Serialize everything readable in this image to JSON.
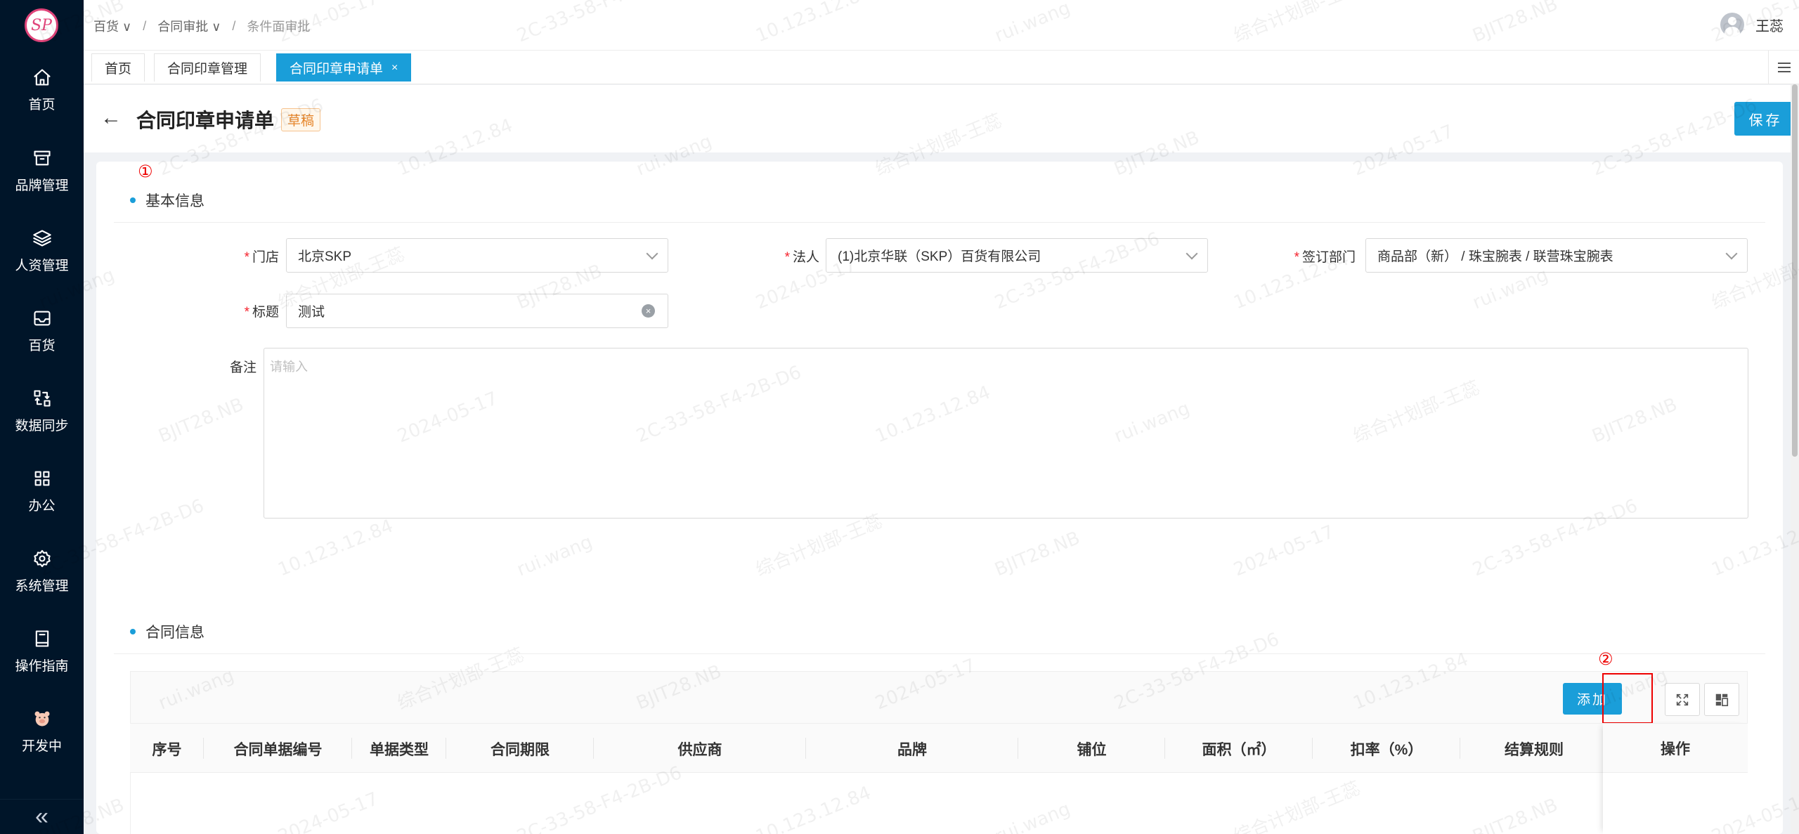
{
  "sidebar": {
    "logo_text": "SP",
    "items": [
      {
        "label": "首页",
        "icon": "home-icon"
      },
      {
        "label": "品牌管理",
        "icon": "archive-box-icon"
      },
      {
        "label": "人资管理",
        "icon": "layers-icon"
      },
      {
        "label": "百货",
        "icon": "inbox-icon"
      },
      {
        "label": "数据同步",
        "icon": "sync-icon"
      },
      {
        "label": "办公",
        "icon": "grid-icon"
      },
      {
        "label": "系统管理",
        "icon": "gear-icon"
      },
      {
        "label": "操作指南",
        "icon": "book-icon"
      },
      {
        "label": "开发中",
        "icon": "pig-icon"
      }
    ],
    "collapse_glyph": "«"
  },
  "header": {
    "breadcrumb": [
      "百货",
      "合同审批",
      "条件面审批"
    ],
    "user_name": "王蕊"
  },
  "tabs": [
    {
      "label": "首页"
    },
    {
      "label": "合同印章管理"
    },
    {
      "label": "合同印章申请单",
      "close": "×"
    }
  ],
  "page": {
    "title": "合同印章申请单",
    "status_badge": "草稿",
    "save_label": "保存",
    "back_glyph": "←"
  },
  "annotations": {
    "mark1": "①",
    "mark2": "②"
  },
  "basic_info": {
    "section_title": "基本信息",
    "store": {
      "label": "门店",
      "value": "北京SKP"
    },
    "legal_person": {
      "label": "法人",
      "value": "(1)北京华联（SKP）百货有限公司"
    },
    "department": {
      "label": "签订部门",
      "value": "商品部（新） / 珠宝腕表 / 联营珠宝腕表"
    },
    "title_field": {
      "label": "标题",
      "value": "测试"
    },
    "remark": {
      "label": "备注",
      "placeholder": "请输入"
    }
  },
  "contract_info": {
    "section_title": "合同信息",
    "add_label": "添加",
    "columns": [
      "序号",
      "合同单据编号",
      "单据类型",
      "合同期限",
      "供应商",
      "品牌",
      "铺位",
      "面积（㎡）",
      "扣率（%）",
      "结算规则",
      "操作"
    ]
  },
  "watermark_text": [
    "BJIT28.NB",
    "2024-05-17",
    "2C-33-58-F4-2B-D6",
    "10.123.12.84",
    "rui.wang",
    "综合计划部-王蕊"
  ]
}
